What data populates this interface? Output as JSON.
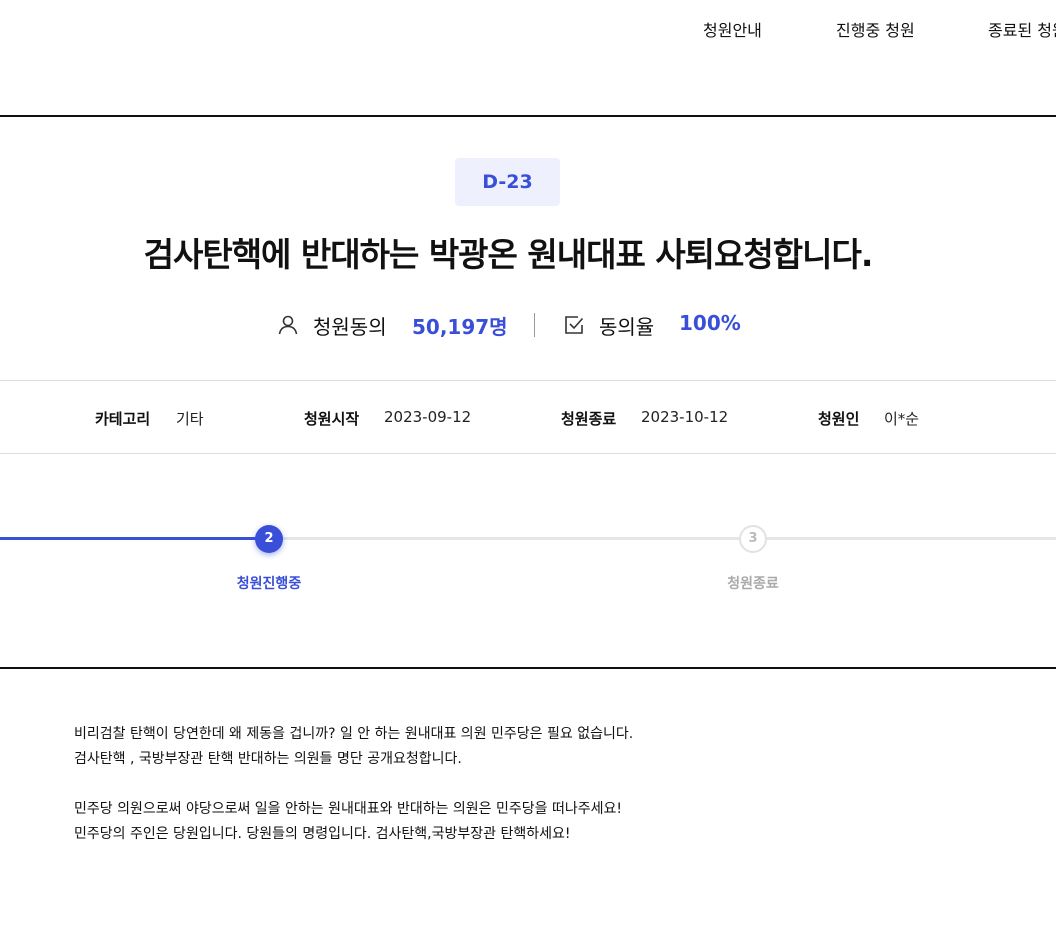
{
  "nav": {
    "items": [
      "청원안내",
      "진행중 청원",
      "종료된 청원"
    ]
  },
  "petition": {
    "dday": "D-23",
    "title": "검사탄핵에 반대하는 박광온 원내대표 사퇴요청합니다.",
    "stats": {
      "agree_label": "청원동의",
      "agree_value": "50,197명",
      "rate_label": "동의율",
      "rate_value": "100%"
    },
    "info": {
      "category_label": "카테고리",
      "category_value": "기타",
      "start_label": "청원시작",
      "start_value": "2023-09-12",
      "end_label": "청원종료",
      "end_value": "2023-10-12",
      "author_label": "청원인",
      "author_value": "이*순"
    },
    "progress": {
      "steps": [
        {
          "number": "2",
          "label": "청원진행중",
          "state": "active"
        },
        {
          "number": "3",
          "label": "청원종료",
          "state": "inactive"
        }
      ]
    },
    "content": {
      "lines": [
        "비리검찰 탄핵이 당연한데 왜 제동을 겁니까? 일 안 하는 원내대표 의원 민주당은 필요 없습니다.",
        "검사탄핵 , 국방부장관 탄핵 반대하는 의원들 명단 공개요청합니다.",
        "",
        "민주당 의원으로써 야당으로써 일을 안하는 원내대표와 반대하는 의원은 민주당을 떠나주세요!",
        "민주당의 주인은 당원입니다. 당원들의 명령입니다. 검사탄핵,국방부장관 탄핵하세요!"
      ]
    }
  },
  "colors": {
    "accent": "#3a4fd8",
    "badge_bg": "#eef1fd",
    "inactive": "#aaaaaa"
  },
  "icons": {
    "agree": "user-icon",
    "rate": "checkbox-icon"
  }
}
